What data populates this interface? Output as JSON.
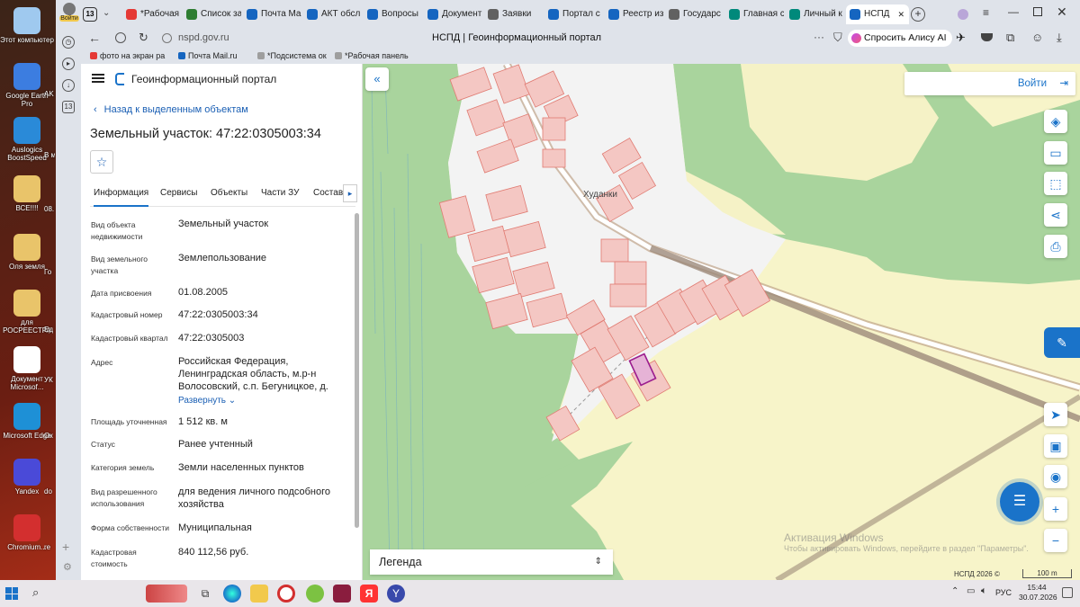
{
  "desktop": {
    "icons": [
      {
        "label": "Этот компьютер",
        "color": "#9fc9ef"
      },
      {
        "label": "Google Earth Pro",
        "color": "#3c7de0"
      },
      {
        "label": "Auslogics BoostSpeed",
        "color": "#2a8ad8"
      },
      {
        "label": "ВСЕ!!!!",
        "color": "#e9c46a"
      },
      {
        "label": "Оля земля",
        "color": "#e9c46a"
      },
      {
        "label": "для РОСРЕЕСТРА",
        "color": "#e9c46a"
      },
      {
        "label": "Документ Microsof...",
        "color": "#ffffff"
      },
      {
        "label": "Microsoft Edge",
        "color": "#1e90d6"
      },
      {
        "label": "Yandex",
        "color": "#4a4ad8"
      },
      {
        "label": "Chromium...",
        "color": "#d32f2f"
      }
    ],
    "partial_labels": [
      "AK",
      "В му",
      "08.",
      "Го",
      "Ед",
      "УК",
      "Ок",
      "do",
      "re"
    ]
  },
  "browser": {
    "profile_label": "Войти",
    "tab_count": "13",
    "tabs": [
      {
        "label": "*Рабочая",
        "color": "#e53935"
      },
      {
        "label": "Список за",
        "color": "#2e7d32"
      },
      {
        "label": "Почта Mai",
        "color": "#1565c0"
      },
      {
        "label": "АКТ обсл",
        "color": "#1565c0"
      },
      {
        "label": "Вопросы",
        "color": "#1565c0"
      },
      {
        "label": "Документ",
        "color": "#1565c0"
      },
      {
        "label": "Заявки",
        "color": "#616161"
      },
      {
        "label": "Портал с",
        "color": "#1565c0"
      },
      {
        "label": "Реестр из",
        "color": "#1565c0"
      },
      {
        "label": "Государс",
        "color": "#616161"
      },
      {
        "label": "Главная с",
        "color": "#00897b"
      },
      {
        "label": "Личный к",
        "color": "#00897b"
      },
      {
        "label": "НСПД",
        "color": "#1565c0"
      }
    ],
    "url": "nspd.gov.ru",
    "page_title": "НСПД | Геоинформационный портал",
    "alice_label": "Спросить Алису AI",
    "bookmarks": [
      "фото на экран ра",
      "Почта Mail.ru",
      "*Подсистема ок",
      "*Рабочая панель"
    ]
  },
  "portal": {
    "title": "Геоинформационный портал",
    "back_link": "Назад к выделенным объектам",
    "object_title": "Земельный участок: 47:22:0305003:34",
    "tabs": [
      "Информация",
      "Сервисы",
      "Объекты",
      "Части ЗУ",
      "Состав"
    ],
    "fields": [
      {
        "label": "Вид объекта недвижимости",
        "value": "Земельный участок"
      },
      {
        "label": "Вид земельного участка",
        "value": "Землепользование"
      },
      {
        "label": "Дата присвоения",
        "value": "01.08.2005"
      },
      {
        "label": "Кадастровый номер",
        "value": "47:22:0305003:34"
      },
      {
        "label": "Кадастровый квартал",
        "value": "47:22:0305003"
      },
      {
        "label": "Адрес",
        "value": "Российская Федерация, Ленинградская область, м.р-н Волосовский, с.п. Бегуницкое, д."
      },
      {
        "label": "Площадь уточненная",
        "value": "1 512 кв. м"
      },
      {
        "label": "Статус",
        "value": "Ранее учтенный"
      },
      {
        "label": "Категория земель",
        "value": "Земли населенных пунктов"
      },
      {
        "label": "Вид разрешенного использования",
        "value": "для ведения личного подсобного хозяйства"
      },
      {
        "label": "Форма собственности",
        "value": "Муниципальная"
      },
      {
        "label": "Кадастровая стоимость",
        "value": "840 112,56 руб."
      }
    ],
    "expand_link": "Развернуть"
  },
  "map": {
    "login_label": "Войти",
    "place_name": "Худанки",
    "legend_label": "Легенда",
    "watermark_title": "Активация Windows",
    "watermark_text": "Чтобы активировать Windows, перейдите в раздел \"Параметры\".",
    "copyright": "НСПД 2026 ©",
    "scale": "100 m"
  },
  "taskbar": {
    "lang": "РУС",
    "time": "15:44",
    "date": "30.07.2026"
  }
}
